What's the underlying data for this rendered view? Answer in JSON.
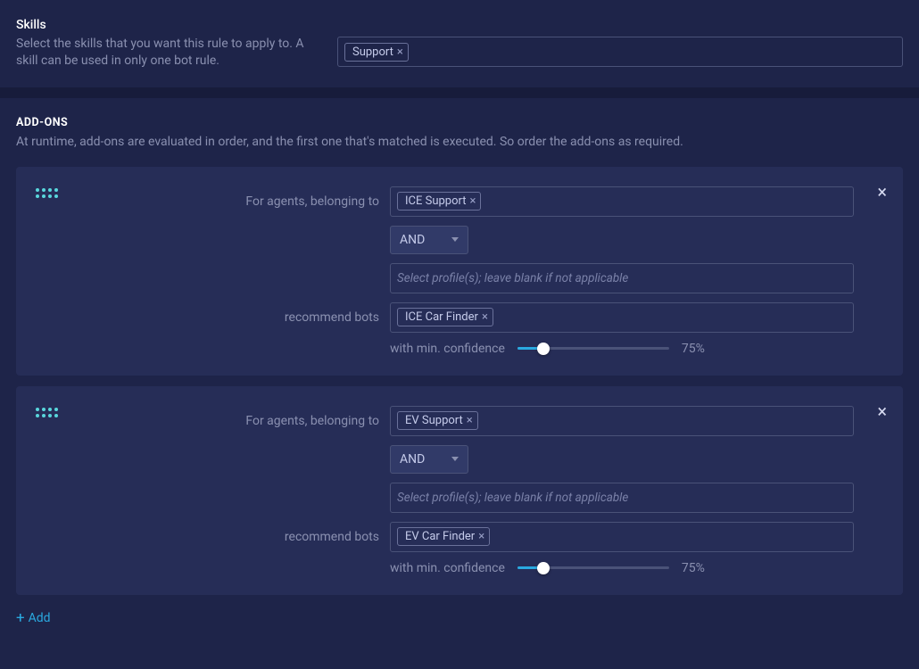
{
  "skills": {
    "title": "Skills",
    "description": "Select the skills that you want this rule to apply to. A skill can be used in only one bot rule.",
    "tags": [
      "Support"
    ]
  },
  "addons": {
    "title": "ADD-ONS",
    "description": "At runtime, add-ons are evaluated in order, and the first one that's matched is executed. So order the add-ons as required.",
    "labels": {
      "for_agents": "For agents, belonging to",
      "recommend_bots": "recommend bots",
      "confidence": "with min. confidence",
      "profiles_placeholder": "Select profile(s); leave blank if not applicable",
      "operator": "AND",
      "add": "Add"
    },
    "items": [
      {
        "groups": [
          "ICE Support"
        ],
        "operator": "AND",
        "profiles_placeholder": "Select profile(s); leave blank if not applicable",
        "bots": [
          "ICE Car Finder"
        ],
        "confidence_pct": 75,
        "confidence_display": "75%",
        "slider_fill_pct": 17
      },
      {
        "groups": [
          "EV Support"
        ],
        "operator": "AND",
        "profiles_placeholder": "Select profile(s); leave blank if not applicable",
        "bots": [
          "EV Car Finder"
        ],
        "confidence_pct": 75,
        "confidence_display": "75%",
        "slider_fill_pct": 17
      }
    ]
  }
}
